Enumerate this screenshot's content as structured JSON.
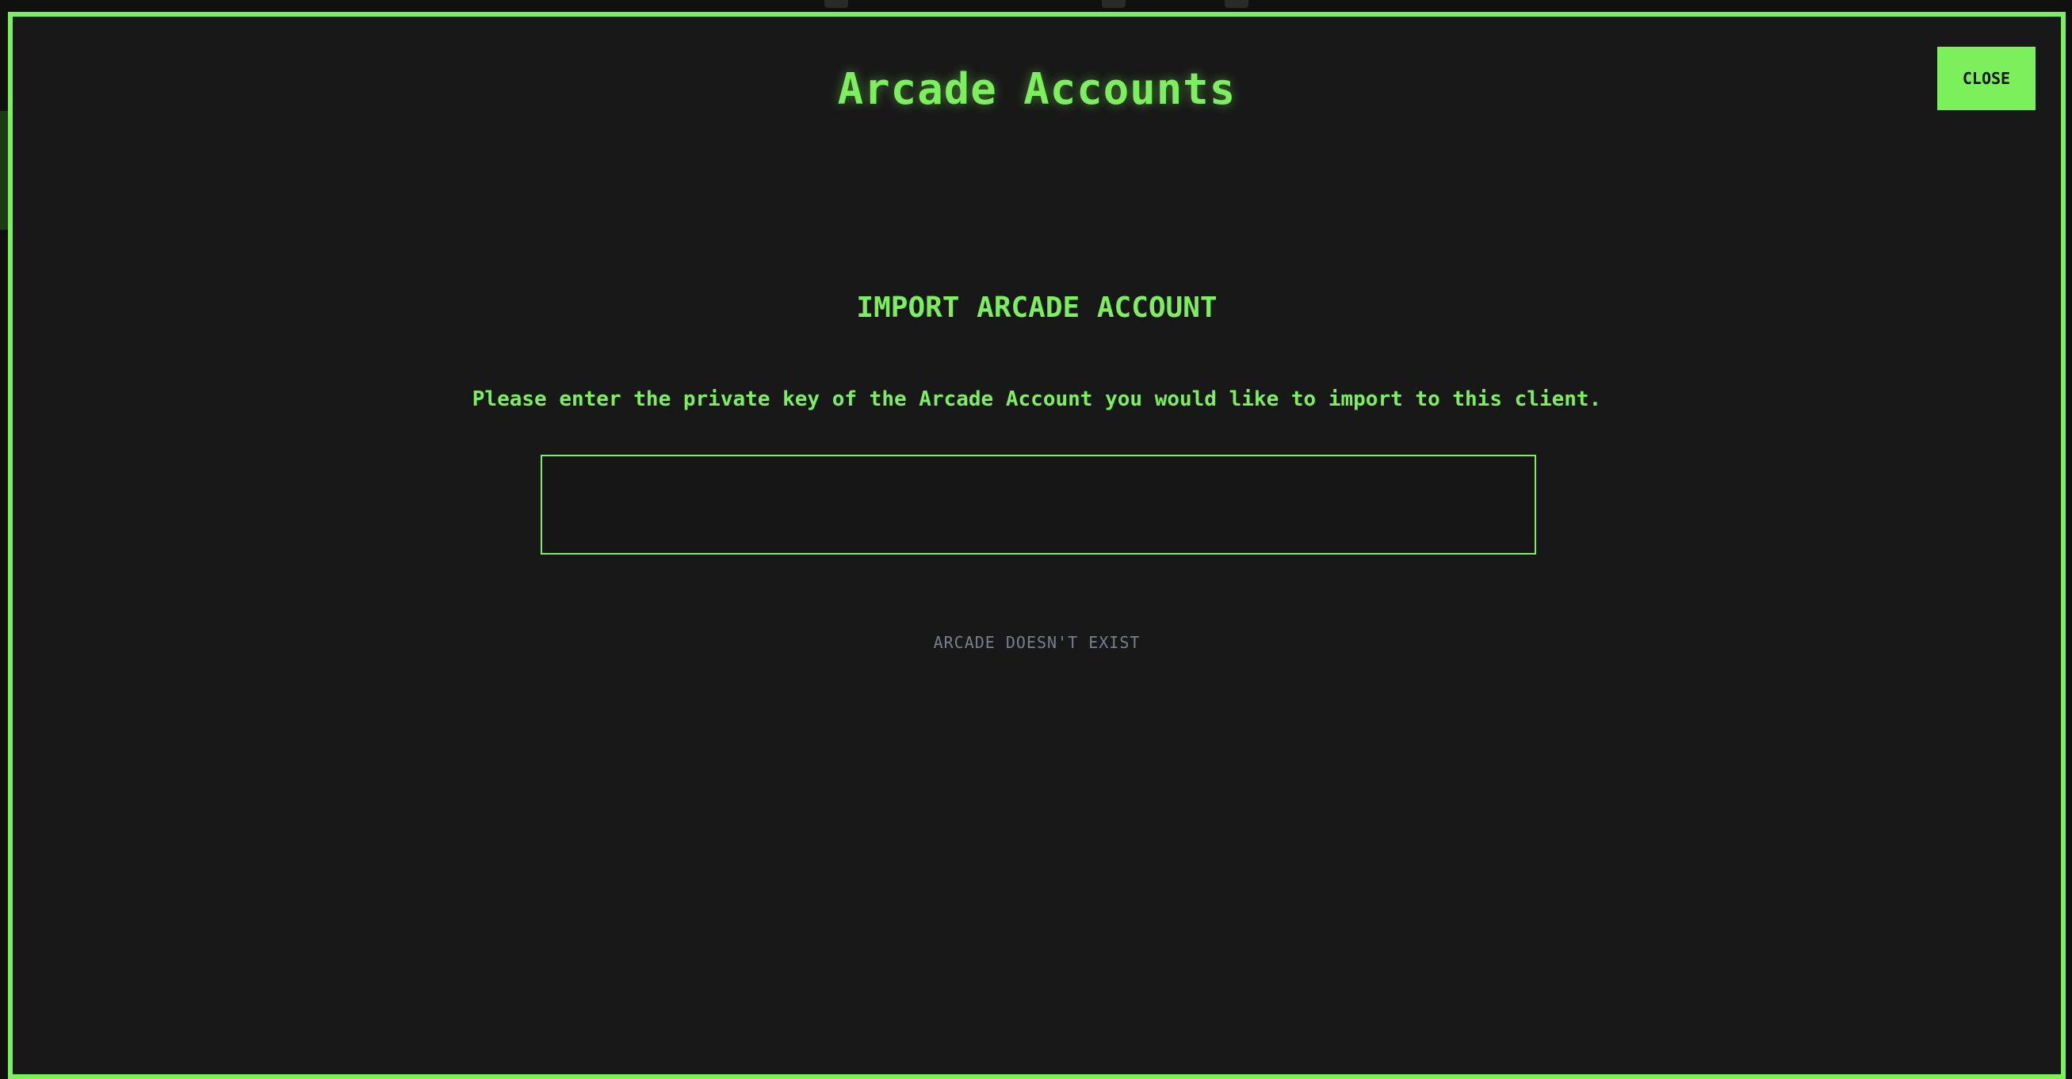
{
  "modal": {
    "title": "Arcade Accounts",
    "close_label": "CLOSE",
    "section_heading": "IMPORT ARCADE ACCOUNT",
    "description": "Please enter the private key of the Arcade Account you would like to import to this client.",
    "private_key_value": "",
    "status": "ARCADE DOESN'T EXIST"
  },
  "colors": {
    "accent": "#7cf05a",
    "background": "#181818",
    "muted_text": "#7a7f8c"
  }
}
